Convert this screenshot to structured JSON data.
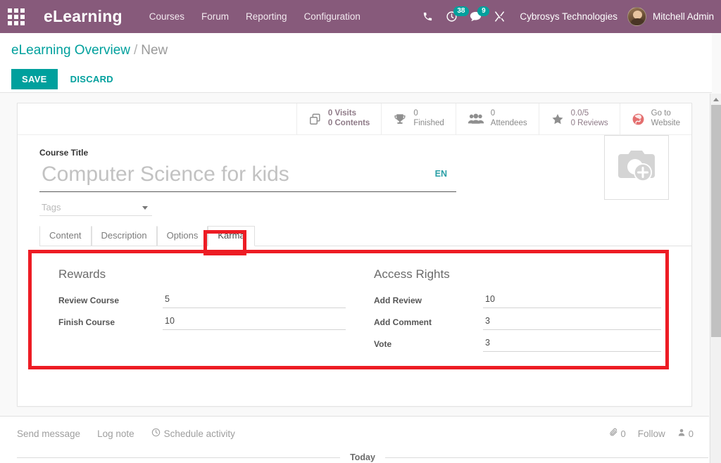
{
  "navbar": {
    "apps_icon": "grid-apps-icon",
    "brand": "eLearning",
    "menus": [
      {
        "label": "Courses"
      },
      {
        "label": "Forum"
      },
      {
        "label": "Reporting"
      },
      {
        "label": "Configuration"
      }
    ],
    "icons": [
      {
        "name": "phone-icon",
        "badge": null
      },
      {
        "name": "activity-clock-icon",
        "badge": "38"
      },
      {
        "name": "messages-icon",
        "badge": "9"
      },
      {
        "name": "debug-tools-icon",
        "badge": null
      }
    ],
    "company": "Cybrosys Technologies",
    "user": "Mitchell Admin",
    "bg_color": "#875a7b",
    "badge_color": "#00a09d"
  },
  "control_panel": {
    "breadcrumb_root": "eLearning Overview",
    "breadcrumb_separator": "/",
    "breadcrumb_current": "New",
    "save_label": "SAVE",
    "discard_label": "DISCARD",
    "accent_color": "#00a09d"
  },
  "stats": [
    {
      "icon": "copy-contents-icon",
      "line1": "0 Visits",
      "line2": "0 Contents",
      "style": "bold"
    },
    {
      "icon": "trophy-icon",
      "line1": "0",
      "line2": "Finished",
      "style": "plain"
    },
    {
      "icon": "attendees-icon",
      "line1": "0",
      "line2": "Attendees",
      "style": "plain"
    },
    {
      "icon": "star-icon",
      "line1": "0.0/5",
      "line2": "0 Reviews",
      "style": "rating"
    },
    {
      "icon": "globe-website-icon",
      "line1": "Go to",
      "line2": "Website",
      "style": "plain"
    }
  ],
  "form": {
    "title_label": "Course Title",
    "title_value": "",
    "title_placeholder": "Computer Science for kids",
    "lang_badge": "EN",
    "tags_value": "",
    "tags_placeholder": "Tags",
    "image_icon": "camera-add-icon"
  },
  "tabs": [
    {
      "label": "Content",
      "active": false
    },
    {
      "label": "Description",
      "active": false
    },
    {
      "label": "Options",
      "active": false
    },
    {
      "label": "Karma",
      "active": true
    }
  ],
  "karma": {
    "rewards": {
      "title": "Rewards",
      "fields": [
        {
          "label": "Review Course",
          "value": "5"
        },
        {
          "label": "Finish Course",
          "value": "10"
        }
      ]
    },
    "access_rights": {
      "title": "Access Rights",
      "fields": [
        {
          "label": "Add Review",
          "value": "10"
        },
        {
          "label": "Add Comment",
          "value": "3"
        },
        {
          "label": "Vote",
          "value": "3"
        }
      ]
    }
  },
  "chatter": {
    "send_message": "Send message",
    "log_note": "Log note",
    "schedule_activity": "Schedule activity",
    "schedule_icon": "clock-icon",
    "attachment_icon": "paperclip-icon",
    "attachment_count": "0",
    "follow_label": "Follow",
    "followers_icon": "user-icon",
    "followers_count": "0",
    "today_label": "Today"
  },
  "annotation": {
    "color": "#ed1c24"
  }
}
